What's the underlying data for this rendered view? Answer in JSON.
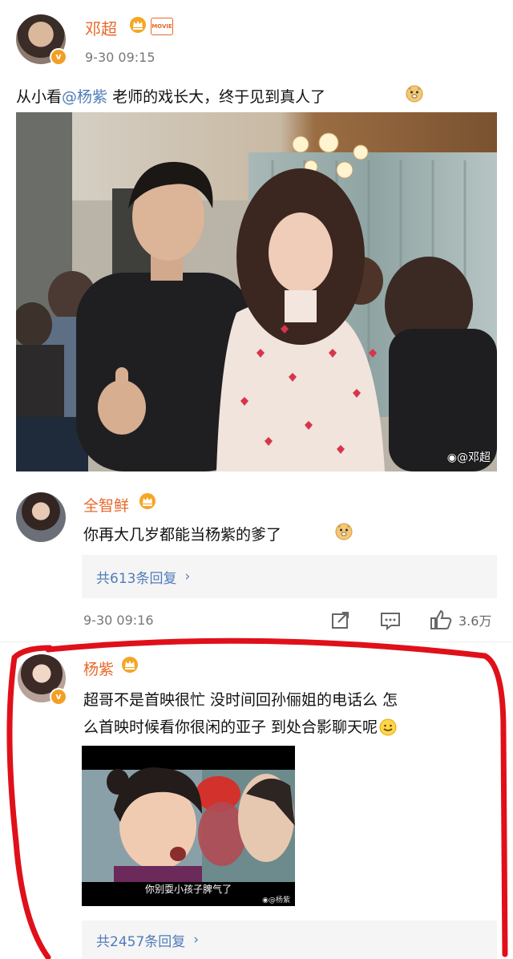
{
  "post": {
    "author": "邓超",
    "badge_text": "MOVIE",
    "time": "9-30 09:15",
    "text_before": "从小看",
    "mention": "@杨紫",
    "text_after": " 老师的戏长大，终于见到真人了",
    "photo_watermark": "@邓超"
  },
  "comments": [
    {
      "author": "全智鲜",
      "text": "你再大几岁都能当杨紫的爹了",
      "replies": "共613条回复",
      "time": "9-30 09:16",
      "likes": "3.6万"
    },
    {
      "author": "杨紫",
      "text_line1": "超哥不是首映很忙 没时间回孙俪姐的电话么 怎",
      "text_line2": "么首映时候看你很闲的亚子 到处合影聊天呢",
      "gif_caption": "你别耍小孩子脾气了",
      "gif_watermark": "@杨紫",
      "replies": "共2457条回复"
    }
  ],
  "colors": {
    "name": "#e8682a",
    "link": "#4f7cba",
    "annotation": "#e0101a"
  }
}
